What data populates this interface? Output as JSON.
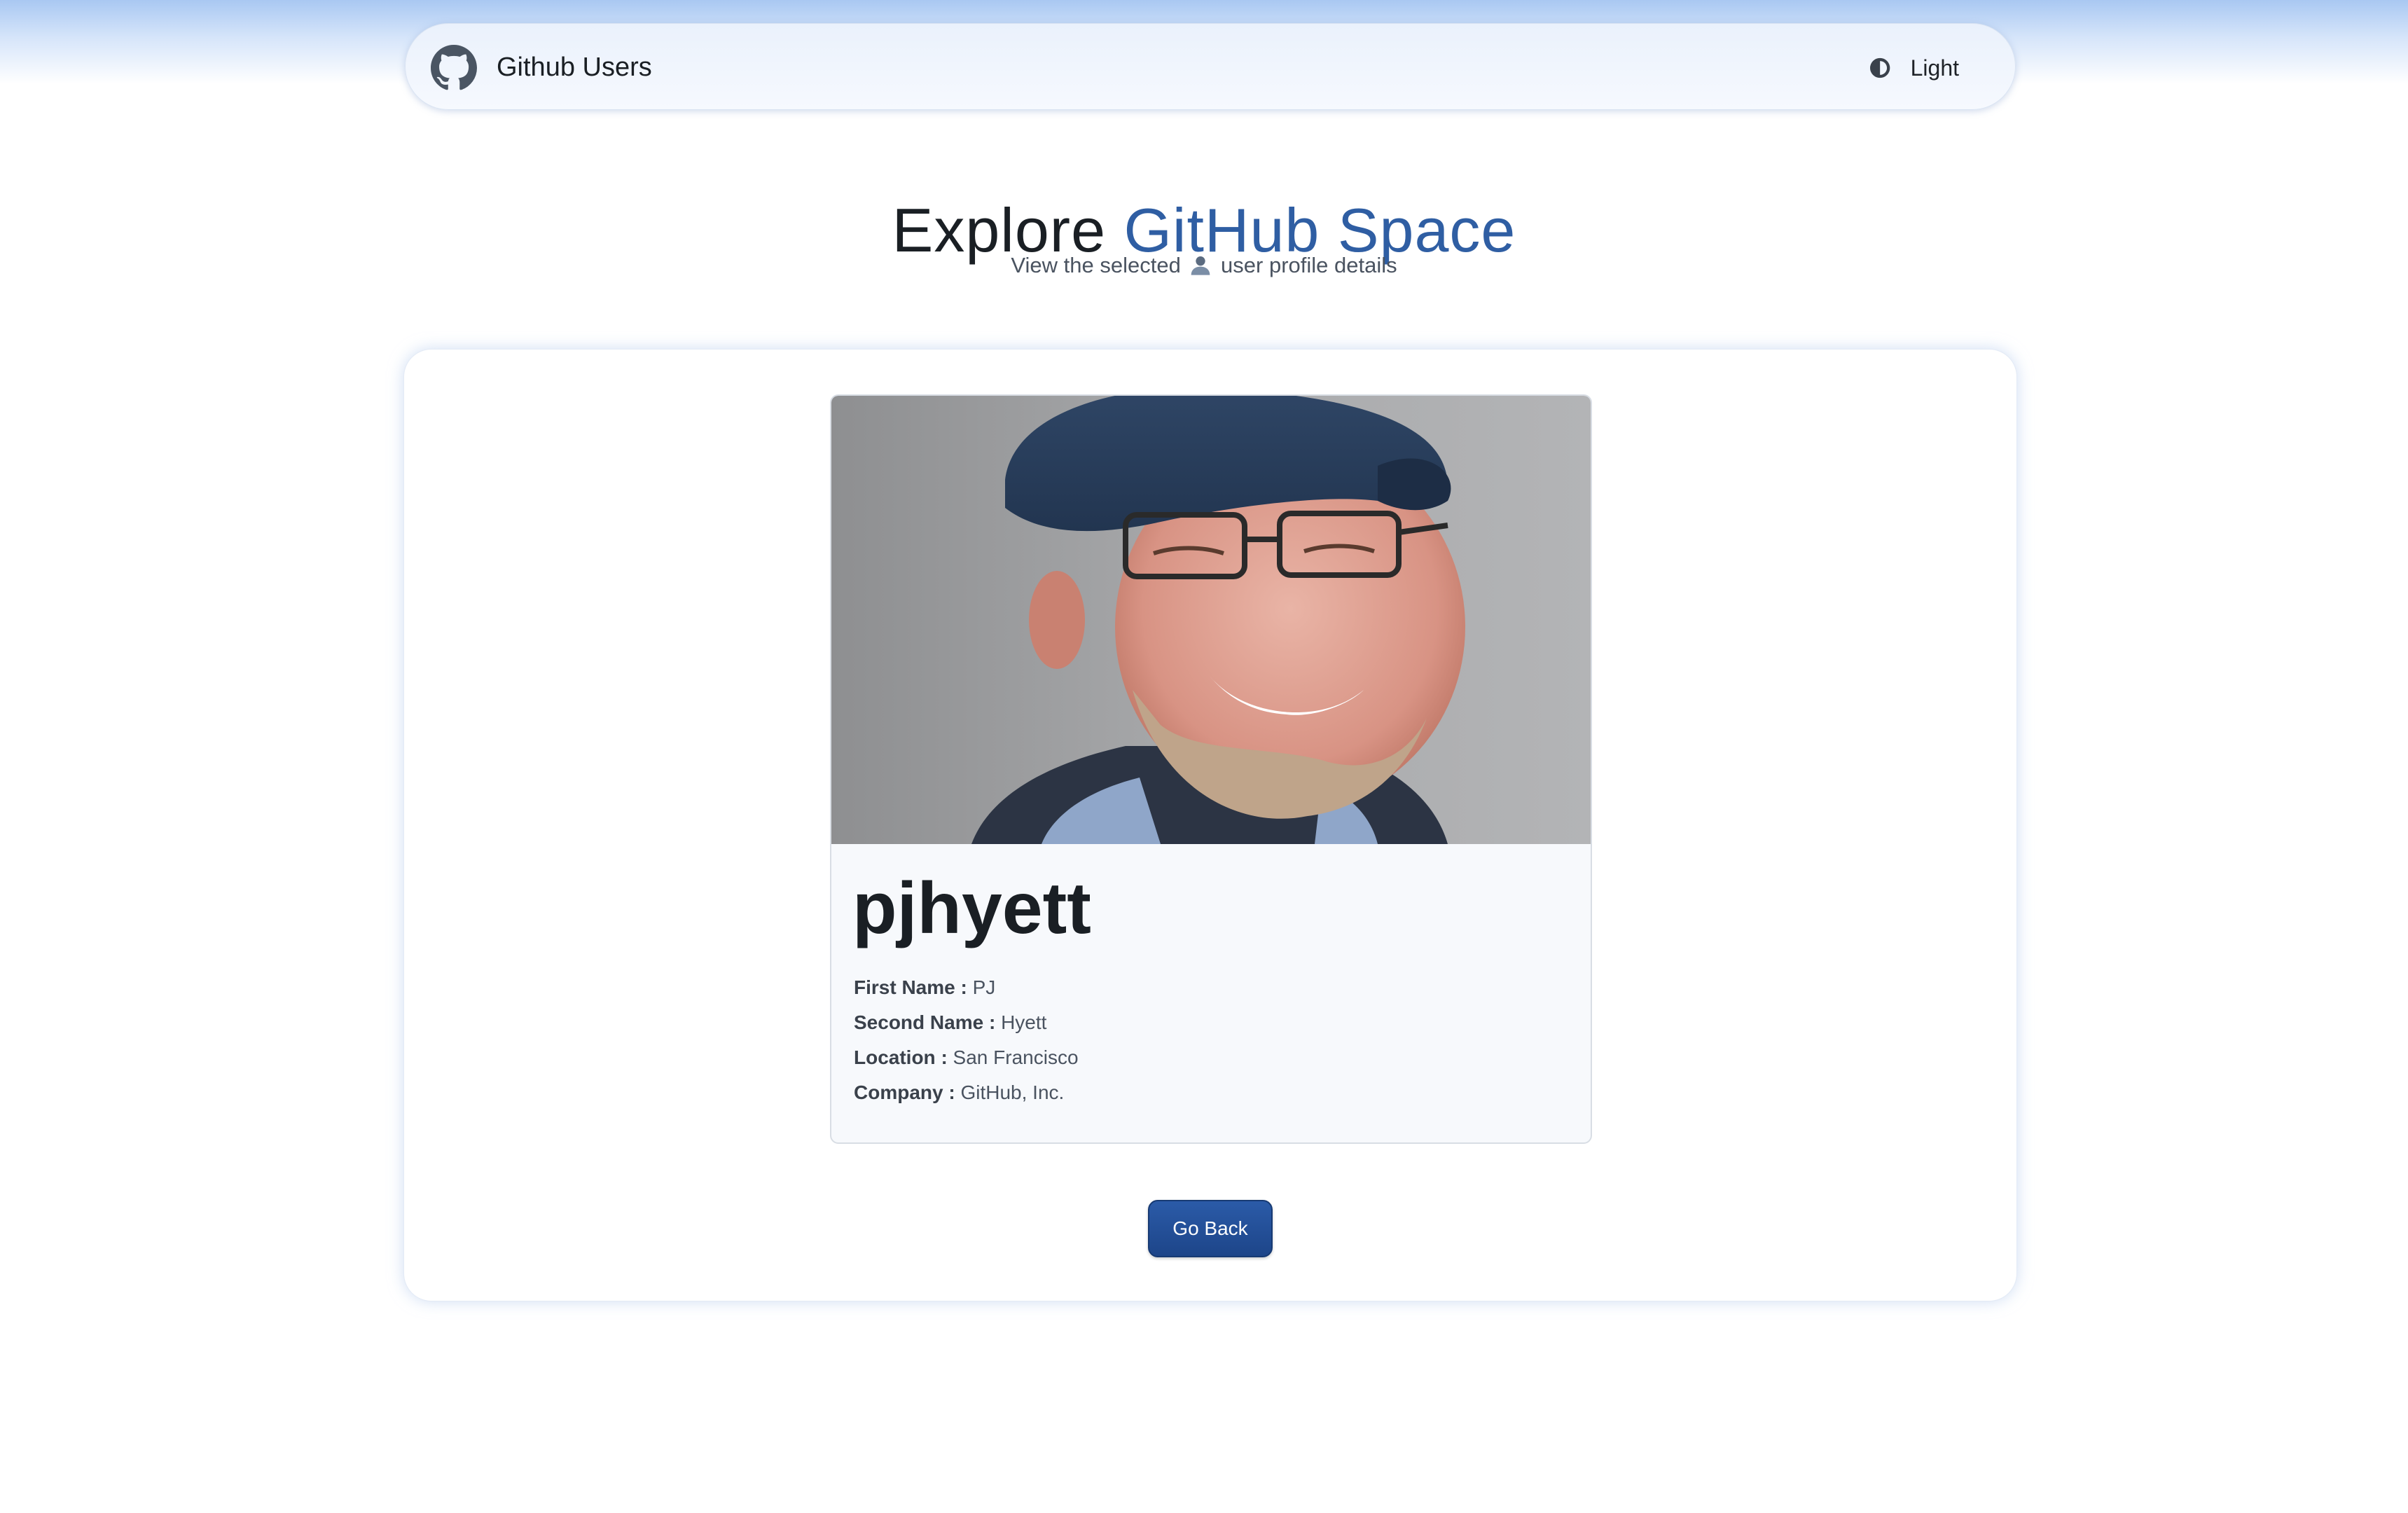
{
  "navbar": {
    "brand_name": "Github Users",
    "brand_icon": "github-icon",
    "theme_icon": "moon-icon",
    "theme_label": "Light"
  },
  "hero": {
    "title_prefix": "Explore ",
    "title_accent": "GitHub Space",
    "subtitle_before": "View the selected ",
    "subtitle_icon": "user-icon",
    "subtitle_after": " user profile details"
  },
  "profile": {
    "username": "pjhyett",
    "fields": [
      {
        "label": "First Name :",
        "value": "PJ"
      },
      {
        "label": "Second Name :",
        "value": "Hyett"
      },
      {
        "label": "Location :",
        "value": "San Francisco"
      },
      {
        "label": "Company :",
        "value": "GitHub, Inc."
      }
    ]
  },
  "actions": {
    "go_back_label": "Go Back"
  },
  "colors": {
    "accent": "#2f5ea3",
    "button": "#1d4589"
  }
}
